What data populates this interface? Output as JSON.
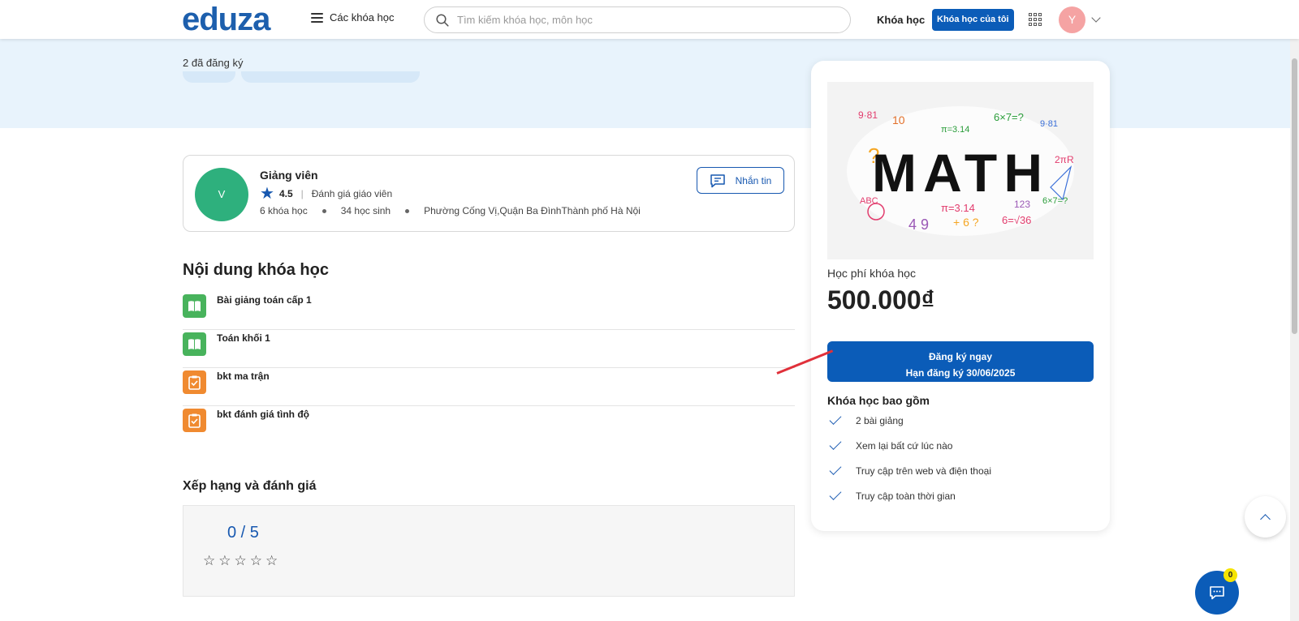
{
  "header": {
    "logo": "eduza",
    "courses_menu": "Các khóa học",
    "search_placeholder": "Tìm kiếm khóa học, môn học",
    "nav_courses": "Khóa học",
    "my_courses": "Khóa học của tôi",
    "avatar_initial": "Y"
  },
  "hero": {
    "enrolled": "2 đã đăng ký"
  },
  "instructor": {
    "avatar_initial": "V",
    "title": "Giảng viên",
    "rating": "4.5",
    "rate_link": "Đánh giá giáo viên",
    "courses": "6 khóa học",
    "students": "34 học sinh",
    "address": "Phường Cống Vị,Quận Ba ĐìnhThành phố Hà Nội",
    "message_label": "Nhắn tin"
  },
  "content": {
    "title": "Nội dung khóa học",
    "lessons": [
      {
        "title": "Bài giảng toán cấp 1",
        "icon": "book-icon"
      },
      {
        "title": "Toán khối 1",
        "icon": "book-icon"
      },
      {
        "title": "bkt ma trận",
        "icon": "clipboard-check-icon"
      },
      {
        "title": "bkt đánh giá tình độ",
        "icon": "clipboard-check-icon"
      }
    ]
  },
  "ratings": {
    "title": "Xếp hạng và đánh giá",
    "score": "0 / 5",
    "stars": 0
  },
  "sidebar": {
    "image_text": "MATH",
    "fee_label": "Học phí khóa học",
    "price": "500.000₫",
    "enroll_label": "Đăng ký ngay",
    "deadline": "Hạn đăng ký 30/06/2025",
    "includes_title": "Khóa học bao gồm",
    "includes": [
      "2 bài giảng",
      "Xem lại bất cứ lúc nào",
      "Truy cập trên web và điện thoại",
      "Truy cập toàn thời gian"
    ]
  },
  "chat": {
    "badge": "0"
  },
  "colors": {
    "brand": "#0b5cb8",
    "hero_bg": "#e8f3fc",
    "instructor_avatar": "#2eb07d"
  }
}
